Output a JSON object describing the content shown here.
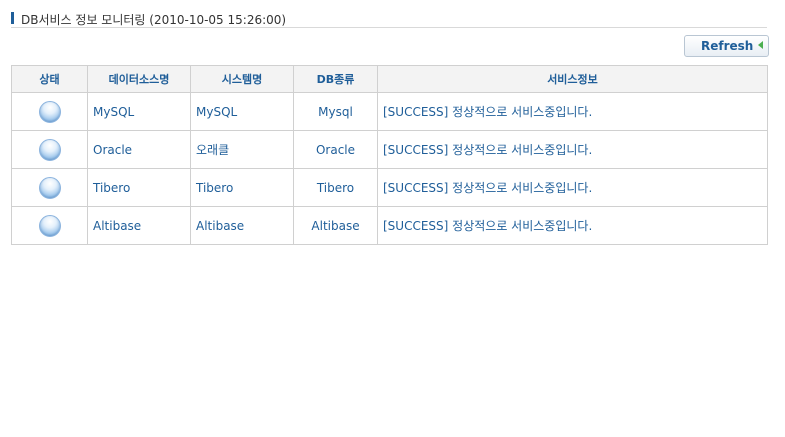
{
  "header": {
    "title": "DB서비스 정보 모니터링 (2010-10-05 15:26:00)"
  },
  "toolbar": {
    "refresh_label": "Refresh",
    "refresh_icon": "arrow-left-icon",
    "refresh_icon_color": "#4caf50"
  },
  "table": {
    "columns": [
      "상태",
      "데이터소스명",
      "시스템명",
      "DB종류",
      "서비스정보"
    ],
    "rows": [
      {
        "status_icon": "status-normal-icon",
        "datasource": "MySQL",
        "system": "MySQL",
        "db_type": "Mysql",
        "service_info": "[SUCCESS] 정상적으로 서비스중입니다."
      },
      {
        "status_icon": "status-normal-icon",
        "datasource": "Oracle",
        "system": "오래클",
        "db_type": "Oracle",
        "service_info": "[SUCCESS] 정상적으로 서비스중입니다."
      },
      {
        "status_icon": "status-normal-icon",
        "datasource": "Tibero",
        "system": "Tibero",
        "db_type": "Tibero",
        "service_info": "[SUCCESS] 정상적으로 서비스중입니다."
      },
      {
        "status_icon": "status-normal-icon",
        "datasource": "Altibase",
        "system": "Altibase",
        "db_type": "Altibase",
        "service_info": "[SUCCESS] 정상적으로 서비스중입니다."
      }
    ]
  },
  "colors": {
    "accent": "#1f5e99",
    "header_bg": "#f3f3f3",
    "border": "#d0d0d0"
  }
}
